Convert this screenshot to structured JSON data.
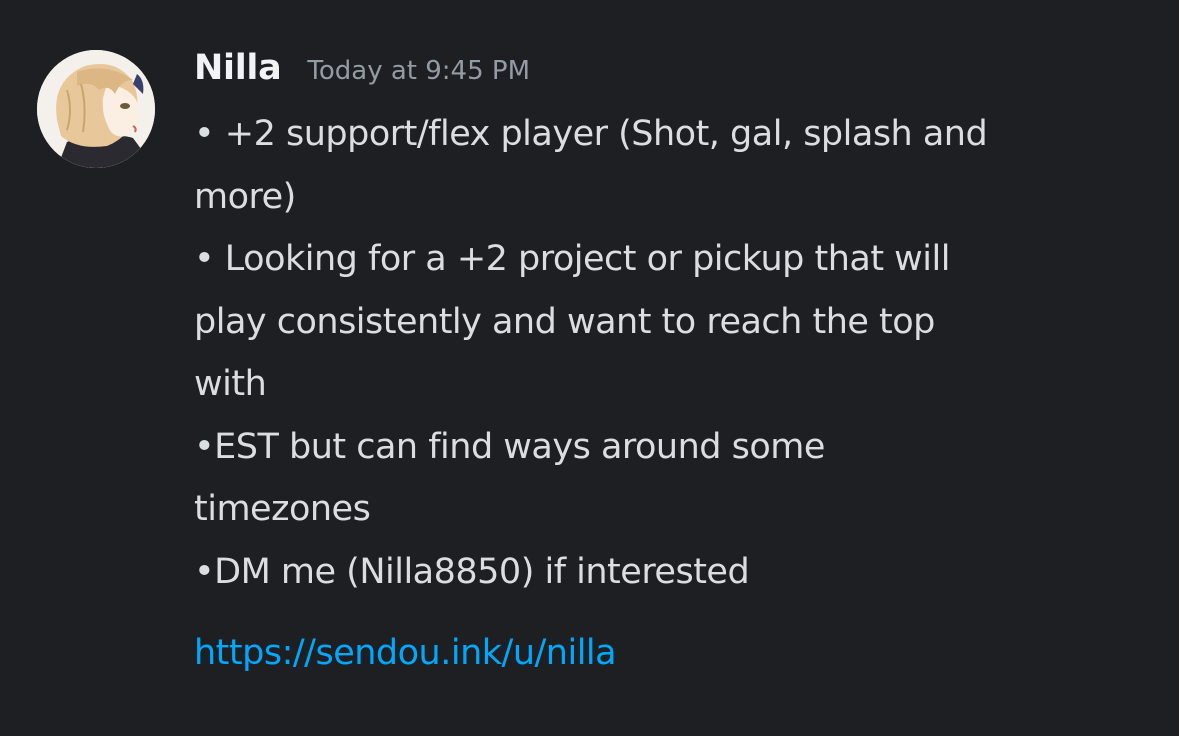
{
  "message": {
    "author": "Nilla",
    "timestamp": "Today at 9:45 PM",
    "avatar_icon": "user-avatar-anime-portrait",
    "lines": [
      "• +2 support/flex player (Shot, gal, splash and",
      "more)",
      "• Looking for a +2 project or pickup that will",
      "play consistently and want to reach the top",
      "with",
      "•EST but can find ways around some",
      "timezones",
      "•DM me (Nilla8850) if interested"
    ],
    "link": "https://sendou.ink/u/nilla"
  },
  "colors": {
    "background": "#1e1f23",
    "username": "#f2f3f5",
    "timestamp": "#949ba4",
    "text": "#dbdee1",
    "link": "#00a8fc"
  }
}
